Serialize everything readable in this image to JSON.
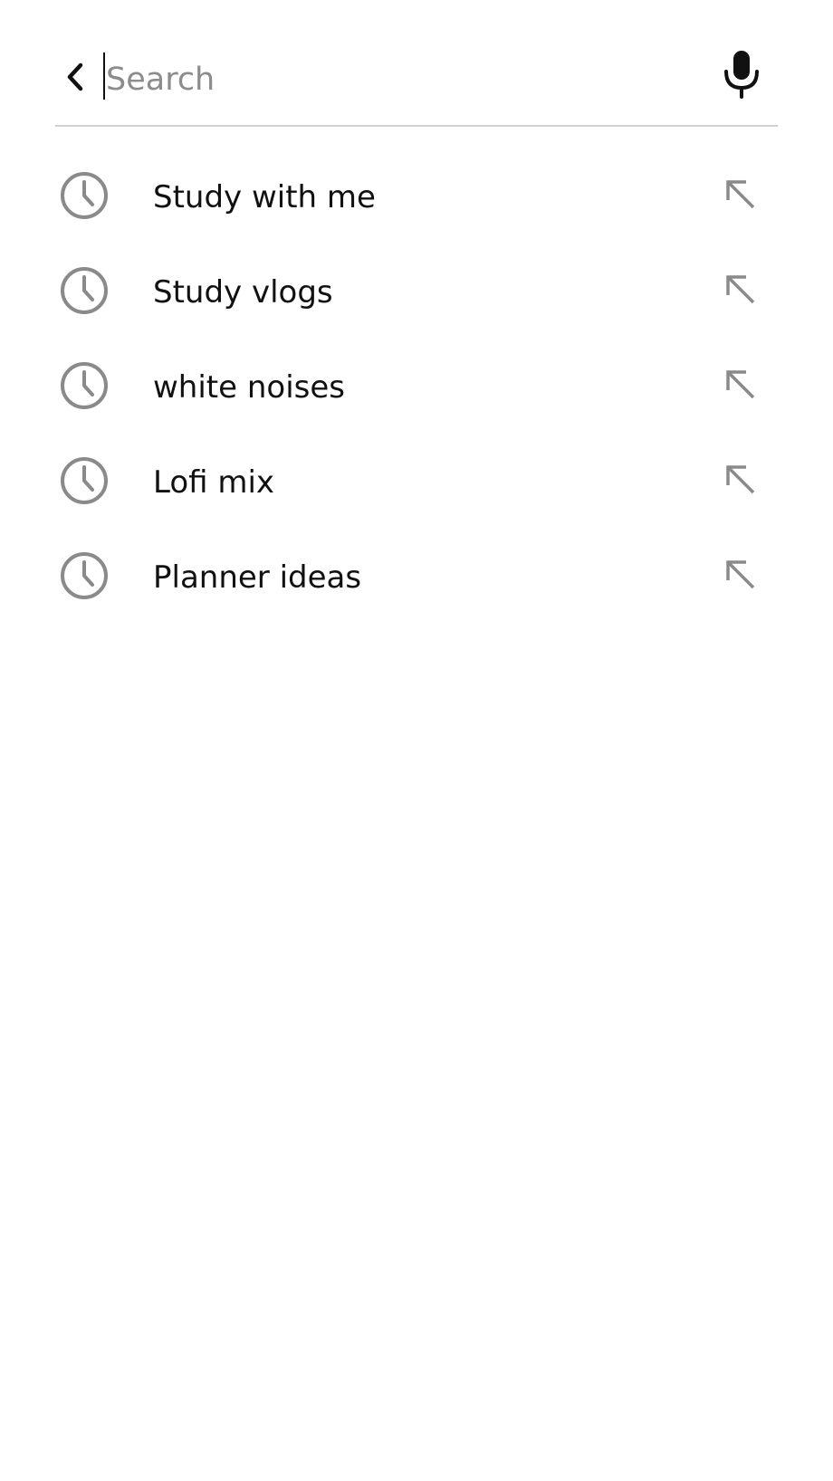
{
  "search": {
    "value": "",
    "placeholder": "Search"
  },
  "icons": {
    "back": "chevron-left-icon",
    "mic": "microphone-icon",
    "history": "clock-icon",
    "fill": "arrow-up-left-icon"
  },
  "colors": {
    "background": "#ffffff",
    "text": "#111111",
    "placeholder": "#8c8c8c",
    "icon_gray": "#8a8a8a",
    "divider": "#d0d0d0"
  },
  "suggestions": [
    {
      "label": "Study with me"
    },
    {
      "label": "Study vlogs"
    },
    {
      "label": "white noises"
    },
    {
      "label": "Lofi mix"
    },
    {
      "label": "Planner ideas"
    }
  ]
}
